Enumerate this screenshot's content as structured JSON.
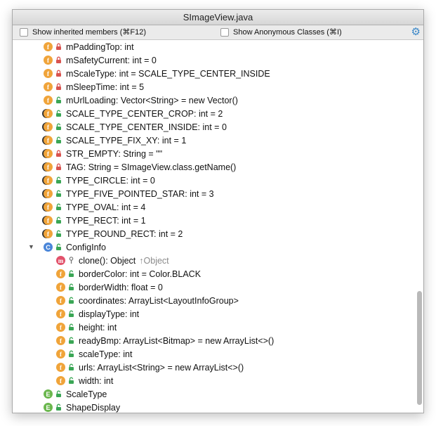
{
  "window": {
    "title": "SImageView.java"
  },
  "toolbar": {
    "show_inherited": "Show inherited members (⌘F12)",
    "show_anonymous": "Show Anonymous Classes (⌘I)",
    "settings_icon": "gear-icon"
  },
  "colors": {
    "field": "#f0a43a",
    "method": "#e2526b",
    "class": "#4a86d9",
    "enum": "#6bb74e",
    "lock_private": "#d9534f",
    "lock_public": "#3aa655"
  },
  "rows": [
    {
      "text": "mPaddingTop: int",
      "icon": "field",
      "access": "private"
    },
    {
      "text": "mSafetyCurrent: int = 0",
      "icon": "field",
      "access": "private"
    },
    {
      "text": "mScaleType: int = SCALE_TYPE_CENTER_INSIDE",
      "icon": "field",
      "access": "private"
    },
    {
      "text": "mSleepTime: int = 5",
      "icon": "field",
      "access": "private"
    },
    {
      "text": "mUrlLoading: Vector<String> = new Vector()",
      "icon": "field",
      "access": "public"
    },
    {
      "text": "SCALE_TYPE_CENTER_CROP: int = 2",
      "icon": "static-final-field",
      "access": "public"
    },
    {
      "text": "SCALE_TYPE_CENTER_INSIDE: int = 0",
      "icon": "static-final-field",
      "access": "public"
    },
    {
      "text": "SCALE_TYPE_FIX_XY: int = 1",
      "icon": "static-final-field",
      "access": "public"
    },
    {
      "text": "STR_EMPTY: String = \"\"",
      "icon": "static-final-field",
      "access": "private"
    },
    {
      "text": "TAG: String = SImageView.class.getName()",
      "icon": "static-final-field",
      "access": "private"
    },
    {
      "text": "TYPE_CIRCLE: int = 0",
      "icon": "static-final-field",
      "access": "public"
    },
    {
      "text": "TYPE_FIVE_POINTED_STAR: int = 3",
      "icon": "static-final-field",
      "access": "public"
    },
    {
      "text": "TYPE_OVAL: int = 4",
      "icon": "static-final-field",
      "access": "public"
    },
    {
      "text": "TYPE_RECT: int = 1",
      "icon": "static-final-field",
      "access": "public"
    },
    {
      "text": "TYPE_ROUND_RECT: int = 2",
      "icon": "static-final-field",
      "access": "public"
    },
    {
      "text": "ConfigInfo",
      "icon": "class",
      "access": "public",
      "expanded": true
    },
    {
      "text": "clone(): Object",
      "override": "↑Object",
      "icon": "method",
      "access": "protected"
    },
    {
      "text": "borderColor: int = Color.BLACK",
      "icon": "field",
      "access": "public"
    },
    {
      "text": "borderWidth: float = 0",
      "icon": "field",
      "access": "public"
    },
    {
      "text": "coordinates: ArrayList<LayoutInfoGroup>",
      "icon": "field",
      "access": "public"
    },
    {
      "text": "displayType: int",
      "icon": "field",
      "access": "public"
    },
    {
      "text": "height: int",
      "icon": "field",
      "access": "public"
    },
    {
      "text": "readyBmp: ArrayList<Bitmap> = new ArrayList<>()",
      "icon": "field",
      "access": "public"
    },
    {
      "text": "scaleType: int",
      "icon": "field",
      "access": "public"
    },
    {
      "text": "urls: ArrayList<String> = new ArrayList<>()",
      "icon": "field",
      "access": "public"
    },
    {
      "text": "width: int",
      "icon": "field",
      "access": "public"
    },
    {
      "text": "ScaleType",
      "icon": "enum",
      "access": "public"
    },
    {
      "text": "ShapeDisplay",
      "icon": "enum",
      "access": "public"
    }
  ]
}
